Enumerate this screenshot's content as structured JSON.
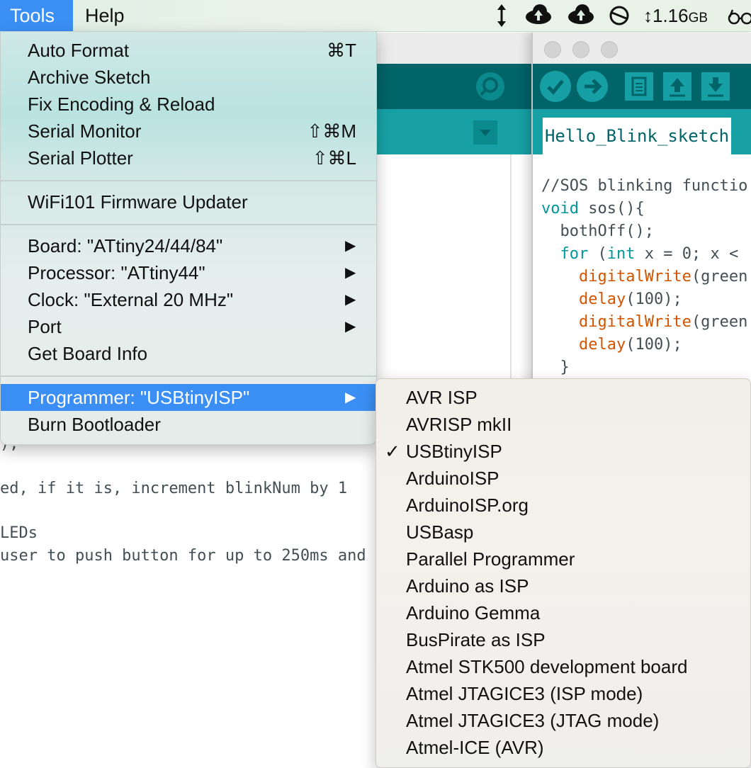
{
  "menubar": {
    "items": [
      "Tools",
      "Help"
    ],
    "status": {
      "memory": "1.16",
      "memory_unit": "GB"
    }
  },
  "background_editor": {
    "code_lines": [
      "),",
      "ed, if it is, increment blinkNum by 1",
      "LEDs",
      "user to push button for up to 250ms and"
    ]
  },
  "ide": {
    "tab": "Hello_Blink_sketch",
    "code": [
      {
        "parts": [
          {
            "t": "//SOS blinking functio",
            "c": "cm"
          }
        ]
      },
      {
        "parts": [
          {
            "t": "void",
            "c": "kw"
          },
          {
            "t": " sos(){",
            "c": "cm"
          }
        ]
      },
      {
        "parts": [
          {
            "t": "  bothOff();",
            "c": "cm"
          }
        ]
      },
      {
        "parts": [
          {
            "t": "  ",
            "c": "cm"
          },
          {
            "t": "for",
            "c": "kw"
          },
          {
            "t": " (",
            "c": "cm"
          },
          {
            "t": "int",
            "c": "kw"
          },
          {
            "t": " x = 0; x <",
            "c": "cm"
          }
        ]
      },
      {
        "parts": [
          {
            "t": "    ",
            "c": "cm"
          },
          {
            "t": "digitalWrite",
            "c": "fn"
          },
          {
            "t": "(green",
            "c": "cm"
          }
        ]
      },
      {
        "parts": [
          {
            "t": "    ",
            "c": "cm"
          },
          {
            "t": "delay",
            "c": "fn"
          },
          {
            "t": "(100);",
            "c": "cm"
          }
        ]
      },
      {
        "parts": [
          {
            "t": "    ",
            "c": "cm"
          },
          {
            "t": "digitalWrite",
            "c": "fn"
          },
          {
            "t": "(green",
            "c": "cm"
          }
        ]
      },
      {
        "parts": [
          {
            "t": "    ",
            "c": "cm"
          },
          {
            "t": "delay",
            "c": "fn"
          },
          {
            "t": "(100);",
            "c": "cm"
          }
        ]
      },
      {
        "parts": [
          {
            "t": "  }",
            "c": "cm"
          }
        ]
      }
    ]
  },
  "tools_menu": {
    "items": [
      {
        "label": "Auto Format",
        "shortcut": "⌘T"
      },
      {
        "label": "Archive Sketch",
        "shortcut": ""
      },
      {
        "label": "Fix Encoding & Reload",
        "shortcut": ""
      },
      {
        "label": "Serial Monitor",
        "shortcut": "⇧⌘M"
      },
      {
        "label": "Serial Plotter",
        "shortcut": "⇧⌘L"
      },
      {
        "label": "WiFi101 Firmware Updater",
        "shortcut": ""
      },
      {
        "label": "Board: \"ATtiny24/44/84\"",
        "submenu": true
      },
      {
        "label": "Processor: \"ATtiny44\"",
        "submenu": true
      },
      {
        "label": "Clock: \"External 20 MHz\"",
        "submenu": true
      },
      {
        "label": "Port",
        "submenu": true
      },
      {
        "label": "Get Board Info",
        "shortcut": ""
      },
      {
        "label": "Programmer: \"USBtinyISP\"",
        "submenu": true
      },
      {
        "label": "Burn Bootloader",
        "shortcut": ""
      }
    ],
    "submenu_arrow": "▶"
  },
  "programmer_submenu": {
    "selected": "USBtinyISP",
    "check_mark": "✓",
    "items": [
      "AVR ISP",
      "AVRISP mkII",
      "USBtinyISP",
      "ArduinoISP",
      "ArduinoISP.org",
      "USBasp",
      "Parallel Programmer",
      "Arduino as ISP",
      "Arduino Gemma",
      "BusPirate as ISP",
      "Atmel STK500 development board",
      "Atmel JTAGICE3 (ISP mode)",
      "Atmel JTAGICE3 (JTAG mode)",
      "Atmel-ICE (AVR)"
    ]
  }
}
